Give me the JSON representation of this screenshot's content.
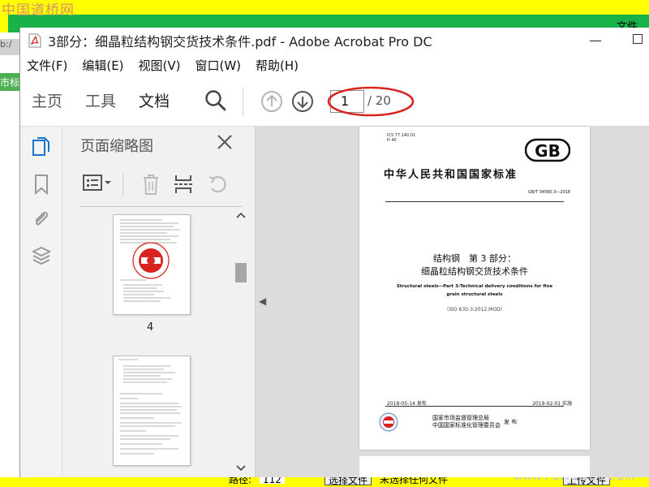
{
  "background": {
    "watermark_top_left": "中国道桥网",
    "watermark_bottom_right": "www.cndao.com",
    "top_right_text": "文件",
    "side_text": "市标",
    "address_fragment": "b:/",
    "bottom_left_text": "路径:",
    "bottom_field_value": "112",
    "bottom_button_1": "选择文件",
    "bottom_status": "未选择任何文件",
    "bottom_button_2": "上传文件"
  },
  "window": {
    "title": "3部分：细晶粒结构钢交货技术条件.pdf - Adobe Acrobat Pro DC",
    "minimize_label": "—"
  },
  "menu": [
    "文件(F)",
    "编辑(E)",
    "视图(V)",
    "窗口(W)",
    "帮助(H)"
  ],
  "toolbar": {
    "tabs": [
      "主页",
      "工具",
      "文档"
    ],
    "active_tab": "文档",
    "current_page": "1",
    "total_pages": "/ 20",
    "highlight_color": "#d9231f"
  },
  "panel": {
    "title": "页面缩略图",
    "thumbnail_label": "4"
  },
  "document": {
    "ics": "ICS 77.140.01",
    "ccs": "H 40",
    "gb_logo": "GB",
    "national_title": "中华人民共和国国家标准",
    "standard_no": "GB/T 34560.3—2018",
    "title_cn_1": "结构钢　第 3 部分：",
    "title_cn_2": "细晶粒结构钢交货技术条件",
    "title_en_1": "Structural steels—Part 3:Technical delivery conditions for fine",
    "title_en_2": "grain structural steels",
    "iso_ref": "（ISO 630-3:2012,MOD）",
    "date_published": "2018-05-14 发布",
    "date_effective": "2019-02-01 实施",
    "issuer_1": "国家市场监督管理总局",
    "issuer_2": "中国国家标准化管理委员会",
    "issue_label": "发 布"
  }
}
